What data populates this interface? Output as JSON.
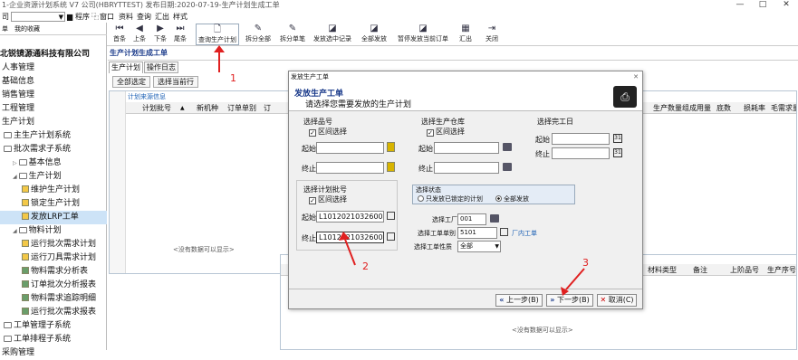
{
  "window": {
    "title": "1-企业资源计划系统 V7 公司(HBRYTTEST) 发布日期:2020-07-19-生产计划生成工单",
    "controls": [
      "—",
      "□",
      "✕"
    ]
  },
  "menu": {
    "company_combo": "司",
    "items": [
      "程序",
      "窗口",
      "资料",
      "查询",
      "汇出",
      "样式"
    ]
  },
  "left_tabs": [
    "单",
    "我的收藏"
  ],
  "toolbar": [
    {
      "label": "首条",
      "icon": "first-record-icon",
      "glyph": "⏮"
    },
    {
      "label": "上条",
      "icon": "prev-record-icon",
      "glyph": "◀"
    },
    {
      "label": "下条",
      "icon": "next-record-icon",
      "glyph": "▶"
    },
    {
      "label": "尾条",
      "icon": "last-record-icon",
      "glyph": "⏭"
    },
    {
      "label": "查询生产计划",
      "icon": "query-doc-icon",
      "glyph": "🗋"
    },
    {
      "label": "拆分全部",
      "icon": "split-all-icon",
      "glyph": "✎"
    },
    {
      "label": "拆分单笔",
      "icon": "split-single-icon",
      "glyph": "✎"
    },
    {
      "label": "发放选中记录",
      "icon": "release-selected-icon",
      "glyph": "◪"
    },
    {
      "label": "全部发放",
      "icon": "release-all-icon",
      "glyph": "◪"
    },
    {
      "label": "暂停发放当前订单",
      "icon": "pause-release-icon",
      "glyph": "◪"
    },
    {
      "label": "汇出",
      "icon": "export-icon",
      "glyph": "▦"
    },
    {
      "label": "关闭",
      "icon": "close-door-icon",
      "glyph": "⇥"
    }
  ],
  "nav": {
    "company": "北锐镜源通科技有限公司",
    "items": [
      {
        "label": "人事管理",
        "type": "top"
      },
      {
        "label": "基础信息",
        "type": "top"
      },
      {
        "label": "销售管理",
        "type": "top"
      },
      {
        "label": "工程管理",
        "type": "top"
      },
      {
        "label": "生产计划",
        "type": "top"
      },
      {
        "label": "主生产计划系统",
        "type": "folder",
        "indent": 0
      },
      {
        "label": "批次需求子系统",
        "type": "folder",
        "indent": 0
      },
      {
        "label": "基本信息",
        "type": "folder",
        "indent": 1,
        "arrow": "▷"
      },
      {
        "label": "生产计划",
        "type": "folder",
        "indent": 1,
        "arrow": "◢"
      },
      {
        "label": "维护生产计划",
        "type": "leaf-y",
        "indent": 2
      },
      {
        "label": "锁定生产计划",
        "type": "leaf-y",
        "indent": 2
      },
      {
        "label": "发放LRP工单",
        "type": "leaf-y",
        "indent": 2,
        "selected": true
      },
      {
        "label": "物料计划",
        "type": "folder",
        "indent": 1,
        "arrow": "◢"
      },
      {
        "label": "运行批次需求计划",
        "type": "leaf-y",
        "indent": 2
      },
      {
        "label": "运行刀具需求计划",
        "type": "leaf-y",
        "indent": 2
      },
      {
        "label": "物料需求分析表",
        "type": "leaf-g",
        "indent": 2
      },
      {
        "label": "订单批次分析报表",
        "type": "leaf-g",
        "indent": 2
      },
      {
        "label": "物料需求追踪明细",
        "type": "leaf-g",
        "indent": 2
      },
      {
        "label": "运行批次需求报表",
        "type": "leaf-g",
        "indent": 2
      },
      {
        "label": "工单管理子系统",
        "type": "folder",
        "indent": 0
      },
      {
        "label": "工单排程子系统",
        "type": "folder",
        "indent": 0
      },
      {
        "label": "采购管理",
        "type": "top"
      }
    ]
  },
  "main": {
    "title": "生产计划生成工单",
    "tabs": [
      "生产计划",
      "操作日志"
    ],
    "buttons": [
      "全部选定",
      "选择当前行"
    ],
    "source_label": "计划来源信息",
    "upper_headers": [
      "计划批号",
      "新机种",
      "订单单别",
      "订"
    ],
    "upper_right_headers": [
      "生产数量",
      "组成用量",
      "底数",
      "损耗率",
      "毛需求量"
    ],
    "lower_headers": [
      "材料类型",
      "备注",
      "上阶品号",
      "生产序号"
    ],
    "empty_text": "<没有数据可以显示>"
  },
  "dialog": {
    "window_title": "发放生产工单",
    "header_title": "发放生产工单",
    "header_subtitle": "请选择您需要发放的生产计划",
    "item_group": {
      "title": "选择品号",
      "range_label": "区间选择",
      "from_label": "起始",
      "to_label": "终止",
      "from_value": "",
      "to_value": ""
    },
    "warehouse_group": {
      "title": "选择生产仓库",
      "range_label": "区间选择",
      "from_label": "起始",
      "to_label": "终止",
      "from_value": "",
      "to_value": ""
    },
    "date_group": {
      "title": "选择完工日",
      "from_label": "起始",
      "to_label": "终止",
      "from_value": "",
      "to_value": ""
    },
    "batch_group": {
      "title": "选择计划批号",
      "range_label": "区间选择",
      "from_label": "起始",
      "to_label": "终止",
      "from_value": "L10120210326001",
      "to_value": "L10120210326001"
    },
    "status_group": {
      "title": "选择状态",
      "option_locked": "只发放已锁定的计划",
      "option_all": "全部发放",
      "selected": "全部发放"
    },
    "factory_label": "选择工厂",
    "factory_value": "001",
    "order_type_label": "选择工单单别",
    "order_type_value": "5101",
    "order_type_desc": "厂内工单",
    "order_nature_label": "选择工单性质",
    "order_nature_value": "全部",
    "buttons": {
      "prev": "上一步(B)",
      "next": "下一步(B)",
      "cancel": "取消(C)"
    }
  },
  "annotations": [
    "1",
    "2",
    "3"
  ],
  "colors": {
    "accent": "#1a5fb4",
    "annotation": "#e02020",
    "selected": "#cde3f7"
  }
}
